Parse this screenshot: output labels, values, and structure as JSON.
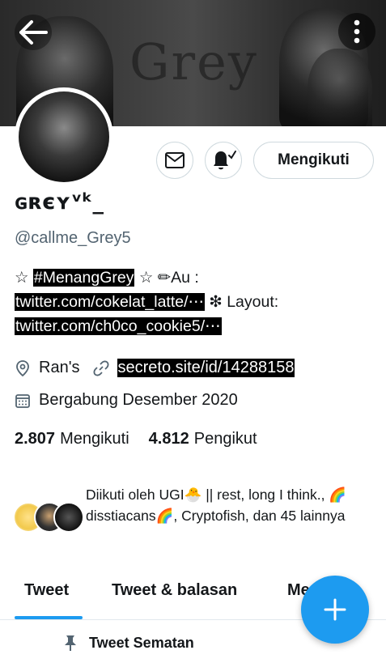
{
  "banner": {
    "word": "Grey"
  },
  "header": {
    "back_icon": "arrow-left-icon",
    "more_icon": "more-vertical-icon"
  },
  "actions": {
    "message_icon": "envelope-icon",
    "notify_icon": "bell-check-icon",
    "follow_label": "Mengikuti"
  },
  "profile": {
    "display_name": "ɢʀєʏᵛᵏ_",
    "handle": "@callme_Grey5",
    "bio": {
      "p1": "☆ ",
      "hashtag": "#MenangGrey",
      "p2": " ☆ ✏Au : ",
      "link1": "twitter.com/cokelat_latte/⋯",
      "p3": " ❇ Layout: ",
      "link2": "twitter.com/ch0co_cookie5/⋯"
    },
    "location": "Ran's",
    "website": "secreto.site/id/14288158",
    "joined": "Bergabung Desember 2020"
  },
  "stats": {
    "following_count": "2.807",
    "following_label": "Mengikuti",
    "followers_count": "4.812",
    "followers_label": "Pengikut"
  },
  "followed_by": {
    "text": "Diikuti oleh UGI🐣 || rest, long I think., 🌈disstiacans🌈, Cryptofish, dan 45 lainnya"
  },
  "tabs": [
    {
      "label": "Tweet"
    },
    {
      "label": "Tweet & balasan"
    },
    {
      "label": "Me"
    }
  ],
  "pinned": {
    "label": "Tweet Sematan"
  },
  "colors": {
    "accent": "#1d9bf0",
    "secondary_text": "#536471",
    "border": "#cfd9de"
  }
}
